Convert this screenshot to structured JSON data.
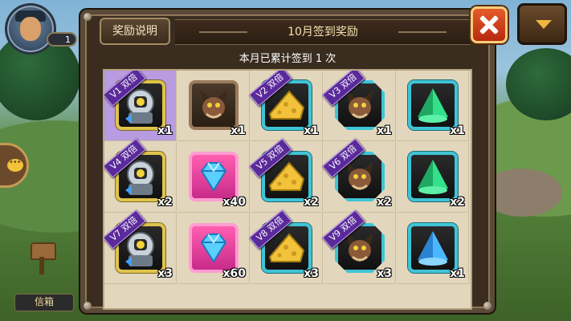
{
  "player": {
    "level": "1"
  },
  "side": {
    "mailbox_label": "信箱"
  },
  "panel": {
    "rules_label": "奖励说明",
    "title": "10月签到奖励",
    "subtitle": "本月已累计签到 1 次"
  },
  "rewards": [
    {
      "item": "armor-hero",
      "frame": "gold",
      "qty": "x1",
      "badge": "V1 双倍",
      "highlight": true
    },
    {
      "item": "rat-hero",
      "frame": "brown",
      "qty": "x1",
      "badge": "",
      "highlight": false
    },
    {
      "item": "cheese",
      "frame": "teal",
      "qty": "x1",
      "badge": "V2 双倍",
      "highlight": false
    },
    {
      "item": "rat-hero",
      "frame": "teal-oct",
      "qty": "x1",
      "badge": "V3 双倍",
      "highlight": false
    },
    {
      "item": "green-crystal",
      "frame": "teal",
      "qty": "x1",
      "badge": "",
      "highlight": false
    },
    {
      "item": "armor-hero",
      "frame": "gold",
      "qty": "x2",
      "badge": "V4 双倍",
      "highlight": false
    },
    {
      "item": "blue-diamond",
      "frame": "pink",
      "qty": "x40",
      "badge": "",
      "highlight": false
    },
    {
      "item": "cheese",
      "frame": "teal",
      "qty": "x2",
      "badge": "V5 双倍",
      "highlight": false
    },
    {
      "item": "rat-hero",
      "frame": "teal-oct",
      "qty": "x2",
      "badge": "V6 双倍",
      "highlight": false
    },
    {
      "item": "green-crystal",
      "frame": "teal",
      "qty": "x2",
      "badge": "",
      "highlight": false
    },
    {
      "item": "armor-hero",
      "frame": "gold",
      "qty": "x3",
      "badge": "V7 双倍",
      "highlight": false
    },
    {
      "item": "blue-diamond",
      "frame": "pink",
      "qty": "x60",
      "badge": "",
      "highlight": false
    },
    {
      "item": "cheese",
      "frame": "teal",
      "qty": "x3",
      "badge": "V8 双倍",
      "highlight": false
    },
    {
      "item": "rat-hero",
      "frame": "teal-oct",
      "qty": "x3",
      "badge": "V9 双倍",
      "highlight": false
    },
    {
      "item": "blue-crystal",
      "frame": "teal",
      "qty": "x1",
      "badge": "",
      "highlight": false
    }
  ],
  "colors": {
    "panel_border": "#5b4a38",
    "grid_bg": "#e2d7bd",
    "vip_badge": "#5a2a9a",
    "highlight": "#b89be0",
    "close_button": "#e65a2a"
  },
  "icons": [
    "close-icon",
    "dropdown-arrow-icon",
    "chat-icon",
    "mailbox-icon",
    "player-avatar"
  ]
}
